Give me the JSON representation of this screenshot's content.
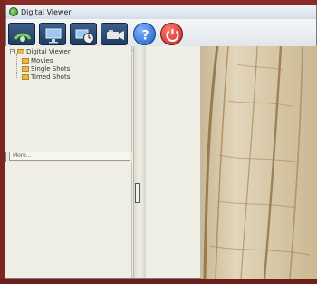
{
  "window": {
    "title": "Digital Viewer"
  },
  "toolbar": {
    "buttons": [
      {
        "name": "record-button",
        "icon": "capture-icon"
      },
      {
        "name": "monitor-button",
        "icon": "monitor-icon"
      },
      {
        "name": "timer-button",
        "icon": "timer-icon"
      },
      {
        "name": "video-button",
        "icon": "video-camera-icon"
      },
      {
        "name": "help-button",
        "icon": "help-icon"
      },
      {
        "name": "exit-button",
        "icon": "power-icon"
      }
    ]
  },
  "tree": {
    "root": "Digital Viewer",
    "children": [
      "Movies",
      "Single Shots",
      "Timed Shots"
    ]
  },
  "more": {
    "label": "More..."
  },
  "colors": {
    "accent": "#1f3d63",
    "help": "#1f5fbf",
    "exit": "#c0221b"
  }
}
